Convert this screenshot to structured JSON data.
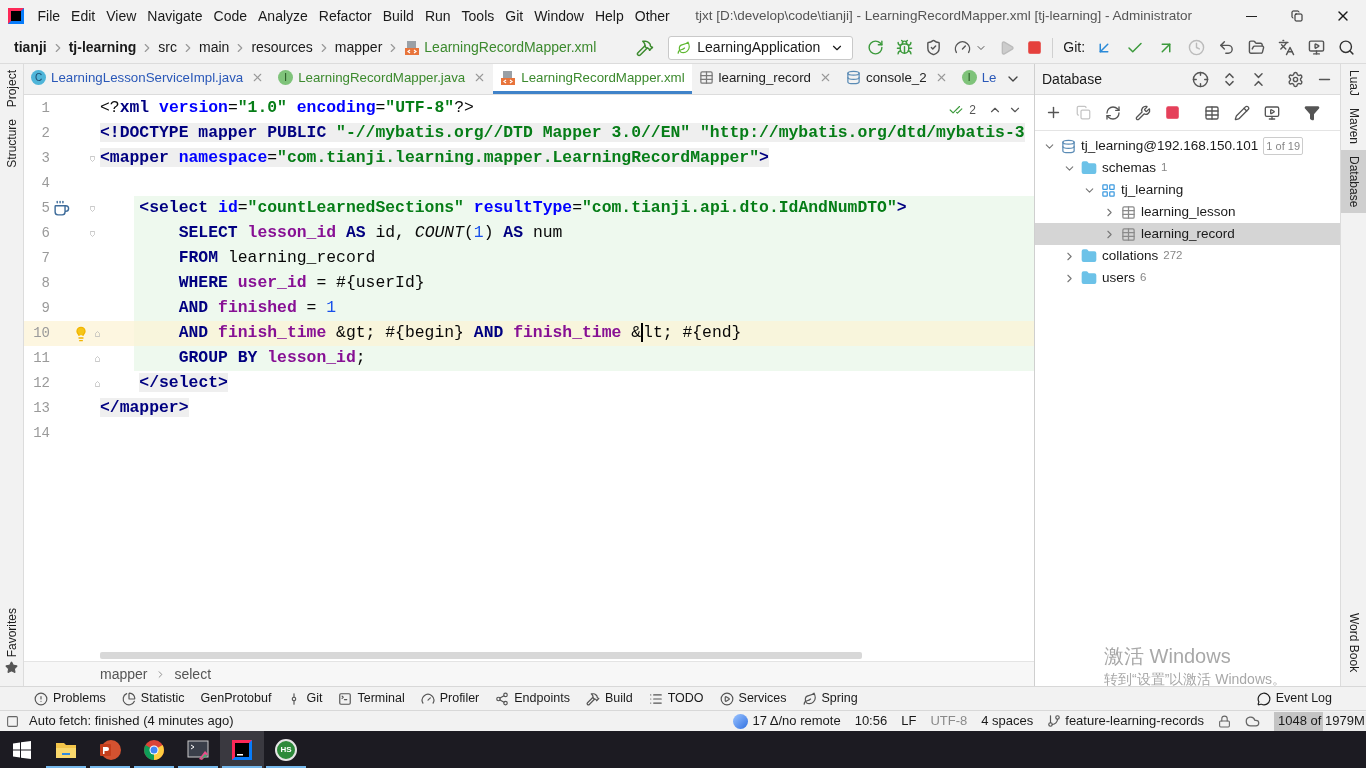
{
  "window": {
    "title": "tjxt [D:\\develop\\code\\tianji] - LearningRecordMapper.xml [tj-learning] - Administrator"
  },
  "menu": [
    "File",
    "Edit",
    "View",
    "Navigate",
    "Code",
    "Analyze",
    "Refactor",
    "Build",
    "Run",
    "Tools",
    "Git",
    "Window",
    "Help",
    "Other"
  ],
  "nav_bar": {
    "crumbs": [
      {
        "label": "tianji",
        "bold": true,
        "kind": "folder"
      },
      {
        "label": "tj-learning",
        "bold": true,
        "kind": "folder"
      },
      {
        "label": "src",
        "bold": false,
        "kind": "folder"
      },
      {
        "label": "main",
        "bold": false,
        "kind": "folder"
      },
      {
        "label": "resources",
        "bold": false,
        "kind": "folder"
      },
      {
        "label": "mapper",
        "bold": false,
        "kind": "folder"
      },
      {
        "label": "LearningRecordMapper.xml",
        "bold": false,
        "kind": "file"
      }
    ],
    "run_config": "LearningApplication",
    "git_label": "Git:"
  },
  "left_tool_strip": [
    {
      "label": "Project",
      "selected": false
    },
    {
      "label": "Structure",
      "selected": false
    },
    {
      "label": "Favorites",
      "selected": false
    }
  ],
  "editor_tabs": [
    {
      "label": "LearningLessonServiceImpl.java",
      "kind": "class",
      "icon_letter": "C",
      "color": "#2a58b8",
      "selected": false,
      "closable": true
    },
    {
      "label": "LearningRecordMapper.java",
      "kind": "interface",
      "icon_letter": "I",
      "color": "#3c8a2e",
      "selected": false,
      "closable": true
    },
    {
      "label": "LearningRecordMapper.xml",
      "kind": "xml",
      "color": "#3c8a2e",
      "selected": true,
      "closable": false
    },
    {
      "label": "learning_record",
      "kind": "table",
      "color": "#222222",
      "selected": false,
      "closable": true
    },
    {
      "label": "console_2",
      "kind": "console",
      "color": "#222222",
      "selected": false,
      "closable": true
    },
    {
      "label": "Le",
      "kind": "interface",
      "icon_letter": "I",
      "color": "#2a58b8",
      "selected": false,
      "closable": false
    }
  ],
  "inspection_widget": {
    "count": "2"
  },
  "code_lines": [
    {
      "number": "1",
      "current": false,
      "injected": false,
      "shaded": false,
      "fold_open": false,
      "fold_close": false,
      "run_marker": false,
      "intention_bulb": false,
      "tokens": [
        {
          "kind": "plain",
          "text": "<?"
        },
        {
          "kind": "tag",
          "text": "xml"
        },
        {
          "kind": "attr",
          "text": " version"
        },
        {
          "kind": "plain",
          "text": "="
        },
        {
          "kind": "value",
          "text": "\"1.0\""
        },
        {
          "kind": "attr",
          "text": " encoding"
        },
        {
          "kind": "plain",
          "text": "="
        },
        {
          "kind": "value",
          "text": "\"UTF-8\""
        },
        {
          "kind": "plain",
          "text": "?>"
        }
      ]
    },
    {
      "number": "2",
      "current": false,
      "injected": false,
      "shaded": true,
      "fold_open": false,
      "fold_close": false,
      "run_marker": false,
      "intention_bulb": false,
      "tokens": [
        {
          "kind": "tag",
          "text": "<!DOCTYPE mapper PUBLIC"
        },
        {
          "kind": "value",
          "text": " \"-//mybatis.org//DTD Mapper 3.0//EN\""
        },
        {
          "kind": "value",
          "text": " \"http://mybatis.org/dtd/mybatis-3"
        }
      ]
    },
    {
      "number": "3",
      "current": false,
      "injected": false,
      "shaded": true,
      "fold_open": true,
      "fold_close": false,
      "run_marker": false,
      "intention_bulb": false,
      "tokens": [
        {
          "kind": "tag",
          "text": "<mapper"
        },
        {
          "kind": "attr",
          "text": " namespace"
        },
        {
          "kind": "plain",
          "text": "="
        },
        {
          "kind": "value",
          "text": "\"com.tianji.learning.mapper.LearningRecordMapper\""
        },
        {
          "kind": "tag",
          "text": ">"
        }
      ]
    },
    {
      "number": "4",
      "current": false,
      "injected": false,
      "fold_open": false,
      "fold_close": false,
      "run_marker": false,
      "intention_bulb": false
    },
    {
      "number": "5",
      "current": false,
      "injected": true,
      "shaded": false,
      "fold_open": true,
      "fold_close": false,
      "run_marker": true,
      "intention_bulb": false,
      "tokens": [
        {
          "kind": "tag",
          "text": "    <select"
        },
        {
          "kind": "attr",
          "text": " id"
        },
        {
          "kind": "plain",
          "text": "="
        },
        {
          "kind": "value",
          "text": "\"countLearnedSections\""
        },
        {
          "kind": "attr",
          "text": " resultType"
        },
        {
          "kind": "plain",
          "text": "="
        },
        {
          "kind": "value",
          "text": "\"com.tianji.api.dto.IdAndNumDTO\""
        },
        {
          "kind": "tag",
          "text": ">"
        }
      ]
    },
    {
      "number": "6",
      "current": false,
      "injected": true,
      "shaded": false,
      "fold_open": true,
      "fold_close": false,
      "run_marker": false,
      "intention_bulb": false,
      "tokens": [
        {
          "kind": "keyword",
          "text": "        SELECT"
        },
        {
          "kind": "column",
          "text": " lesson_id"
        },
        {
          "kind": "keyword",
          "text": " AS"
        },
        {
          "kind": "plain",
          "text": " id, "
        },
        {
          "kind": "function",
          "text": "COUNT"
        },
        {
          "kind": "plain",
          "text": "("
        },
        {
          "kind": "number",
          "text": "1"
        },
        {
          "kind": "plain",
          "text": ") "
        },
        {
          "kind": "keyword",
          "text": "AS"
        },
        {
          "kind": "plain",
          "text": " num"
        }
      ]
    },
    {
      "number": "7",
      "current": false,
      "injected": true,
      "shaded": false,
      "fold_open": false,
      "fold_close": false,
      "run_marker": false,
      "intention_bulb": false,
      "tokens": [
        {
          "kind": "keyword",
          "text": "        FROM"
        },
        {
          "kind": "plain",
          "text": " learning_record"
        }
      ]
    },
    {
      "number": "8",
      "current": false,
      "injected": true,
      "shaded": false,
      "fold_open": false,
      "fold_close": false,
      "run_marker": false,
      "intention_bulb": false,
      "tokens": [
        {
          "kind": "keyword",
          "text": "        WHERE"
        },
        {
          "kind": "column",
          "text": " user_id"
        },
        {
          "kind": "plain",
          "text": " = #{userId}"
        }
      ]
    },
    {
      "number": "9",
      "current": false,
      "injected": true,
      "shaded": false,
      "fold_open": false,
      "fold_close": false,
      "run_marker": false,
      "intention_bulb": false,
      "tokens": [
        {
          "kind": "keyword",
          "text": "        AND"
        },
        {
          "kind": "column",
          "text": " finished"
        },
        {
          "kind": "plain",
          "text": " = "
        },
        {
          "kind": "number",
          "text": "1"
        }
      ]
    },
    {
      "number": "10",
      "current": true,
      "injected": true,
      "shaded": false,
      "fold_open": false,
      "fold_close": true,
      "run_marker": false,
      "intention_bulb": true,
      "tokens": [
        {
          "kind": "keyword",
          "text": "        AND"
        },
        {
          "kind": "column",
          "text": " finish_time"
        },
        {
          "kind": "plain",
          "text": " &gt; #{begin} "
        },
        {
          "kind": "keyword",
          "text": "AND"
        },
        {
          "kind": "column",
          "text": " finish_time"
        },
        {
          "kind": "plain",
          "text": " &"
        },
        {
          "kind": "caret"
        },
        {
          "kind": "plain",
          "text": "lt; #{end}"
        }
      ]
    },
    {
      "number": "11",
      "current": false,
      "injected": true,
      "shaded": false,
      "fold_open": false,
      "fold_close": true,
      "run_marker": false,
      "intention_bulb": false,
      "tokens": [
        {
          "kind": "keyword",
          "text": "        GROUP BY"
        },
        {
          "kind": "column",
          "text": " lesson_id"
        },
        {
          "kind": "plain",
          "text": ";"
        }
      ]
    },
    {
      "number": "12",
      "current": false,
      "injected": false,
      "shaded": true,
      "fold_open": false,
      "fold_close": true,
      "run_marker": false,
      "intention_bulb": false,
      "tokens": [
        {
          "kind": "tag",
          "text": "    </select>"
        }
      ]
    },
    {
      "number": "13",
      "current": false,
      "injected": false,
      "shaded": true,
      "fold_open": false,
      "fold_close": false,
      "run_marker": false,
      "intention_bulb": false,
      "tokens": [
        {
          "kind": "tag",
          "text": "</mapper>"
        }
      ]
    },
    {
      "number": "14",
      "current": false,
      "injected": false,
      "fold_open": false,
      "fold_close": false,
      "run_marker": false,
      "intention_bulb": false
    }
  ],
  "editor_breadcrumb": [
    "mapper",
    "select"
  ],
  "database_panel": {
    "title": "Database",
    "tree": [
      {
        "label": "tj_learning@192.168.150.101",
        "kind": "connection",
        "badge": "1 of 19",
        "expanded": true,
        "selected": false,
        "children": [
          {
            "label": "schemas",
            "kind": "folder",
            "count": "1",
            "expanded": true,
            "selected": false,
            "children": [
              {
                "label": "tj_learning",
                "kind": "schema",
                "expanded": true,
                "selected": false,
                "children": [
                  {
                    "label": "learning_lesson",
                    "kind": "table",
                    "expanded": false,
                    "selected": false
                  },
                  {
                    "label": "learning_record",
                    "kind": "table",
                    "expanded": false,
                    "selected": true
                  }
                ]
              }
            ]
          },
          {
            "label": "collations",
            "kind": "folder",
            "count": "272",
            "expanded": false,
            "selected": false
          },
          {
            "label": "users",
            "kind": "folder",
            "count": "6",
            "expanded": false,
            "selected": false
          }
        ]
      }
    ]
  },
  "right_tool_strip": [
    {
      "label": "LuaJ",
      "selected": false
    },
    {
      "label": "Maven",
      "selected": false
    },
    {
      "label": "Database",
      "selected": true
    },
    {
      "label": "Word Book",
      "selected": false
    }
  ],
  "tool_windows": [
    "Problems",
    "Statistic",
    "GenProtobuf",
    "Git",
    "Terminal",
    "Profiler",
    "Endpoints",
    "Build",
    "TODO",
    "Services",
    "Spring"
  ],
  "event_log": "Event Log",
  "status_bar": {
    "message": "Auto fetch: finished (4 minutes ago)",
    "items": [
      {
        "text": "17 Δ/no remote",
        "dimmed": false
      },
      {
        "text": "10:56",
        "dimmed": false
      },
      {
        "text": "LF",
        "dimmed": false
      },
      {
        "text": "UTF-8",
        "dimmed": true
      },
      {
        "text": "4 spaces",
        "dimmed": false
      },
      {
        "text": "feature-learning-records",
        "dimmed": false
      }
    ],
    "memory": {
      "text": "1048 of 1979M",
      "level": 0.53
    }
  },
  "taskbar": [
    {
      "kind": "start",
      "running": false,
      "selected": false
    },
    {
      "kind": "explorer",
      "running": true,
      "selected": false
    },
    {
      "kind": "powerpoint",
      "running": true,
      "selected": false
    },
    {
      "kind": "chrome",
      "running": true,
      "selected": false
    },
    {
      "kind": "terminal",
      "running": true,
      "selected": false
    },
    {
      "kind": "intellij",
      "running": true,
      "selected": true
    },
    {
      "kind": "hs",
      "label": "HS",
      "running": true,
      "selected": false
    }
  ],
  "activation_notice": {
    "title": "激活 Windows",
    "text": "转到“设置”以激活 Windows。"
  }
}
